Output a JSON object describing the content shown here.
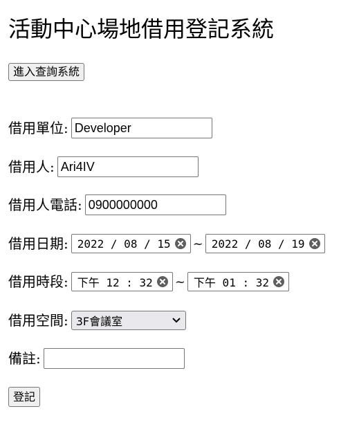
{
  "page": {
    "title": "活動中心場地借用登記系統",
    "query_button_label": "進入查詢系統",
    "submit_button_label": "登記"
  },
  "form": {
    "unit": {
      "label": "借用單位:",
      "value": "Developer"
    },
    "borrower": {
      "label": "借用人:",
      "value": "Ari4IV"
    },
    "phone": {
      "label": "借用人電話:",
      "value": "0900000000"
    },
    "date": {
      "label": "借用日期:",
      "start": "2022 / 08 / 15",
      "end": "2022 / 08 / 19",
      "separator": "~"
    },
    "time": {
      "label": "借用時段:",
      "start": "下午 12 : 32",
      "end": "下午 01 : 32",
      "separator": "~"
    },
    "space": {
      "label": "借用空間:",
      "selected": "3F會議室"
    },
    "note": {
      "label": "備註:",
      "value": ""
    }
  },
  "icons": {
    "clear": "circle-x-icon",
    "dropdown": "chevron-down-icon"
  }
}
